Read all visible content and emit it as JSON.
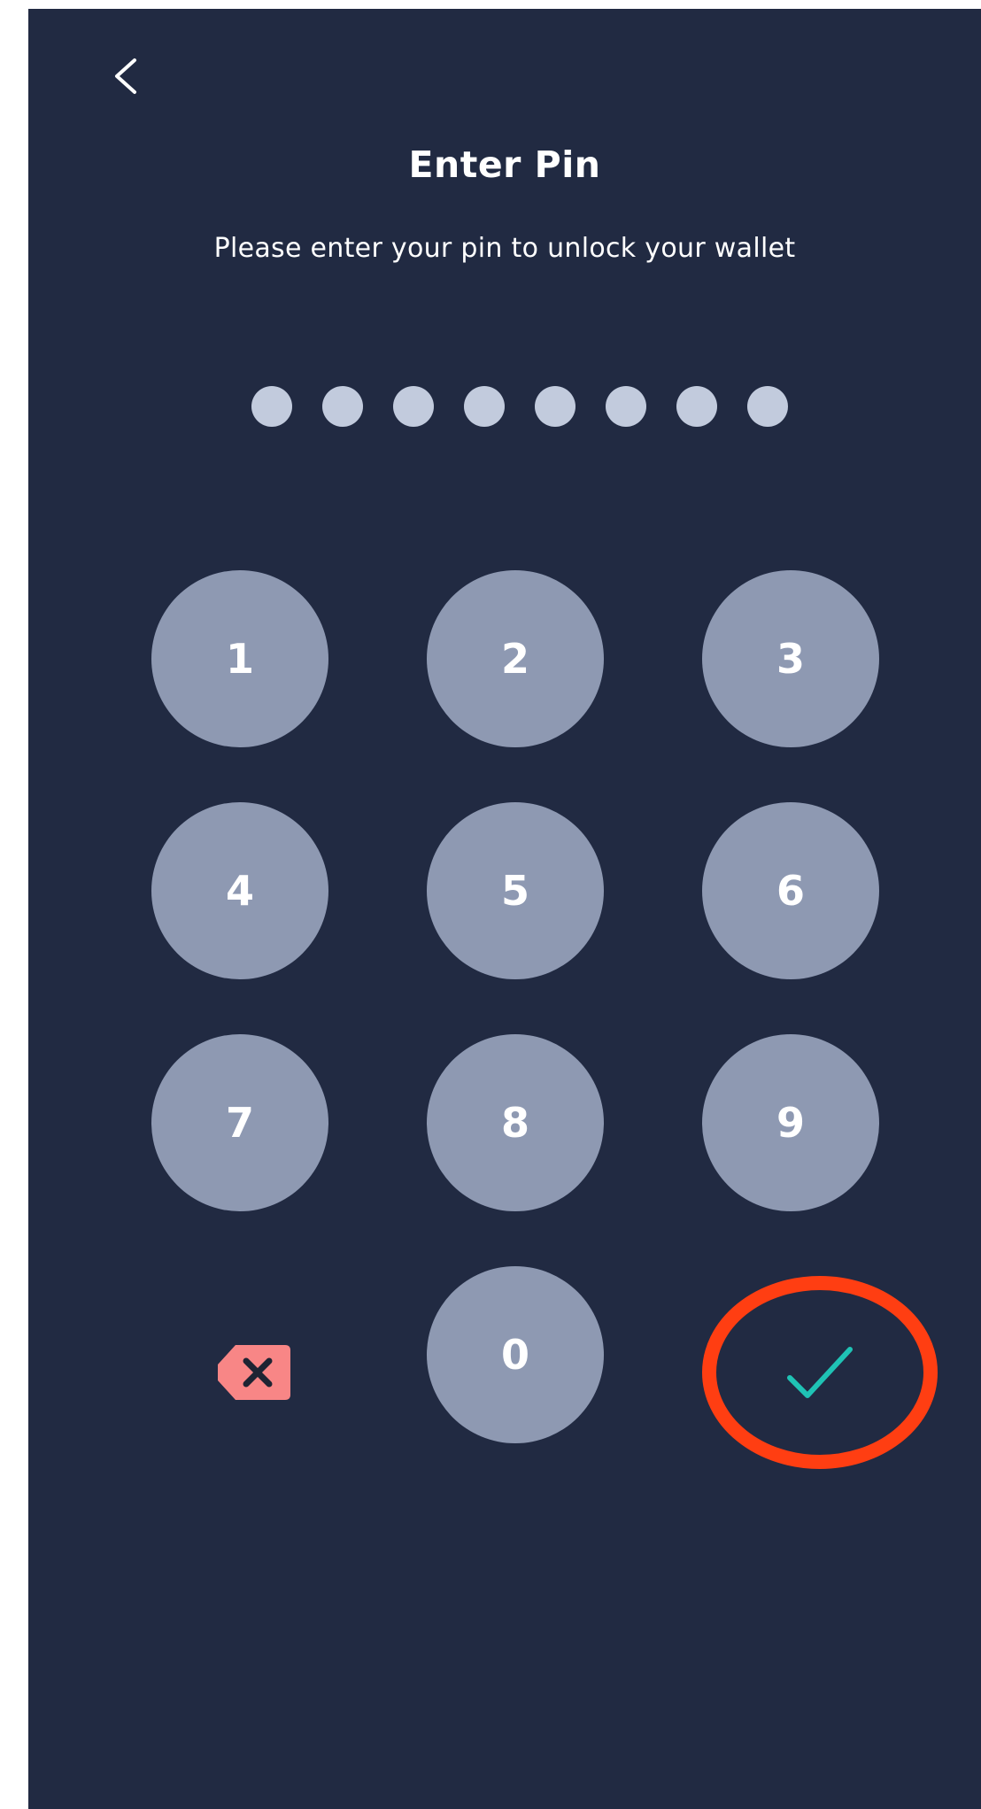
{
  "header": {
    "back_icon": "chevron-left-icon",
    "title": "Enter Pin",
    "subtitle": "Please enter your pin to unlock your wallet"
  },
  "pin": {
    "entered_count": 8
  },
  "keypad": {
    "keys": [
      "1",
      "2",
      "3",
      "4",
      "5",
      "6",
      "7",
      "8",
      "9",
      "0"
    ],
    "delete_icon": "backspace-icon",
    "confirm_icon": "checkmark-icon"
  },
  "colors": {
    "background": "#212a42",
    "key_fill": "#8e99b2",
    "pin_dot": "#c2cbdd",
    "delete_accent": "#f88686",
    "confirm_accent": "#1fc3b5",
    "highlight_ring": "#ff3e12"
  }
}
